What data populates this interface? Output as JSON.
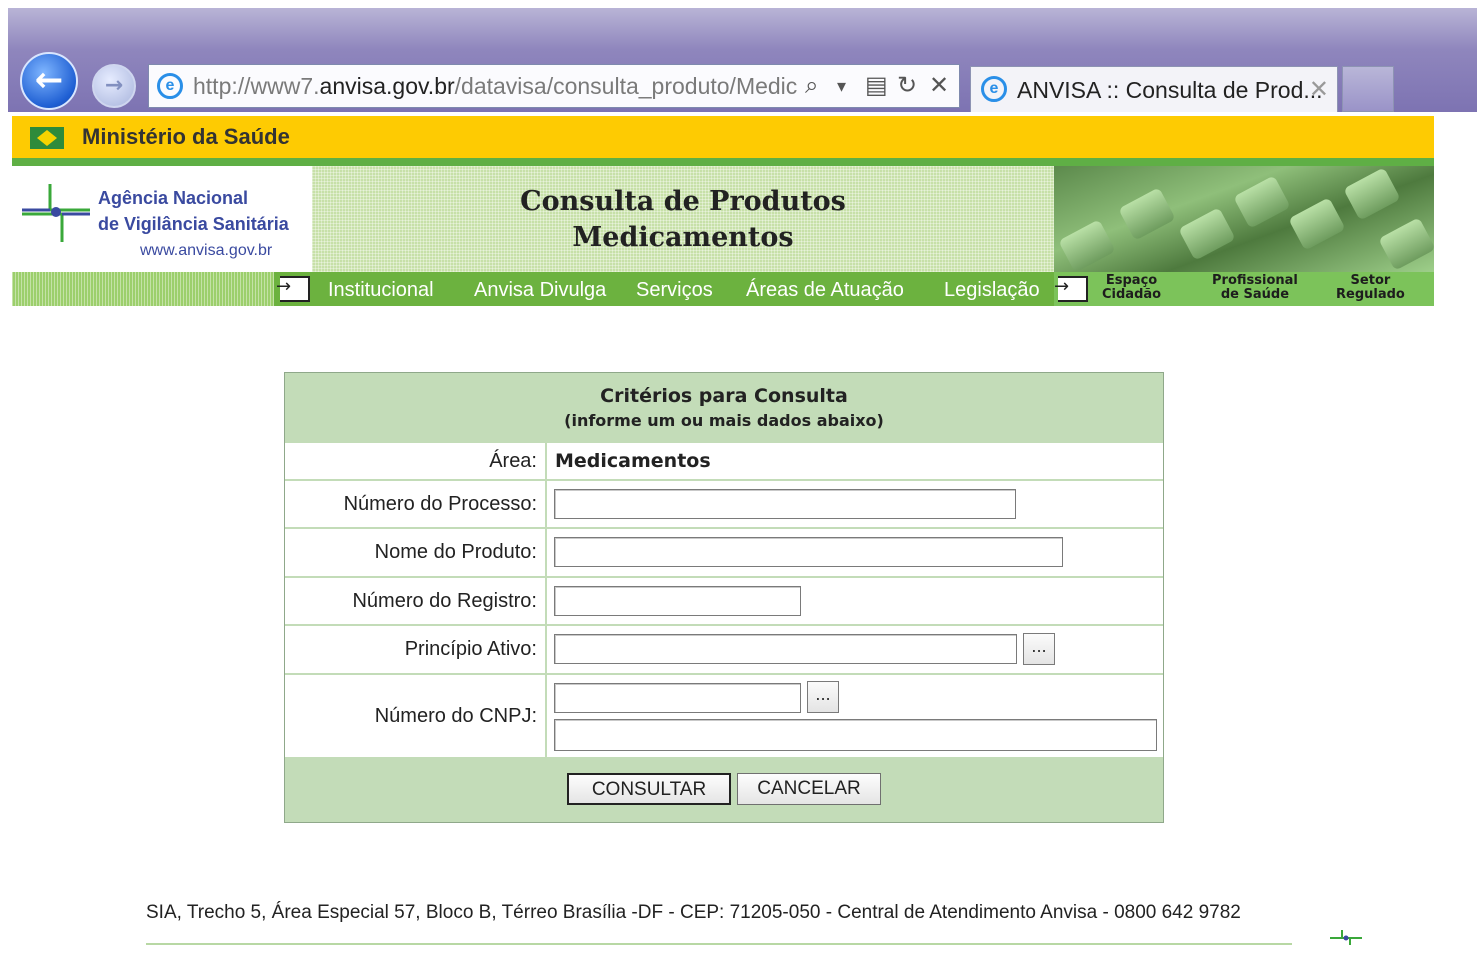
{
  "browser": {
    "url_prefix": "http://www7.",
    "url_domain": "anvisa.gov.br",
    "url_path": "/datavisa/consulta_produto/Medic",
    "search_glyph": "⌕",
    "dropdown_glyph": "▾",
    "compat_glyph": "▤",
    "refresh_glyph": "↻",
    "stop_glyph": "✕",
    "tab_title": "ANVISA :: Consulta de Prod...",
    "tab_close": "✕",
    "back_glyph": "←",
    "forward_glyph": "→",
    "ie_glyph": "e"
  },
  "site": {
    "ministry": "Ministério da Saúde",
    "agency_line1": "Agência Nacional",
    "agency_line2": "de Vigilância Sanitária",
    "agency_site": "www.anvisa.gov.br",
    "banner_line1": "Consulta de Produtos",
    "banner_line2": "Medicamentos"
  },
  "menu": {
    "items": [
      "Institucional",
      "Anvisa Divulga",
      "Serviços",
      "Áreas de Atuação",
      "Legislação"
    ],
    "right_items": [
      {
        "line1": "Espaço",
        "line2": "Cidadão"
      },
      {
        "line1": "Profissional",
        "line2": "de Saúde"
      },
      {
        "line1": "Setor",
        "line2": "Regulado"
      }
    ]
  },
  "form": {
    "title": "Critérios para Consulta",
    "subtitle": "(informe um ou mais dados abaixo)",
    "area_label": "Área:",
    "area_value": "Medicamentos",
    "processo_label": "Número do Processo:",
    "processo_value": "",
    "produto_label": "Nome do Produto:",
    "produto_value": "",
    "registro_label": "Número do Registro:",
    "registro_value": "",
    "principio_label": "Princípio Ativo:",
    "principio_value": "",
    "cnpj_label": "Número do CNPJ:",
    "cnpj_value": "",
    "cnpj_name_value": "",
    "lookup_label": "...",
    "consultar": "CONSULTAR",
    "cancelar": "CANCELAR"
  },
  "footer": {
    "address": "SIA, Trecho 5, Área Especial 57, Bloco B, Térreo Brasília -DF - CEP: 71205-050 - Central de Atendimento Anvisa - 0800 642 9782"
  },
  "colors": {
    "gov_yellow": "#fecb02",
    "anvisa_green": "#6cb23f",
    "form_green": "#c3dcb8",
    "logo_blue": "#3a4aa0"
  }
}
